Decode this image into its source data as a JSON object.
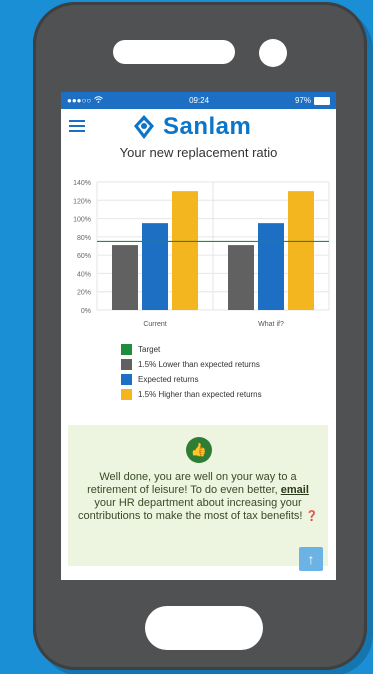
{
  "status": {
    "signal": "●●●○○",
    "wifi": "wifi-icon",
    "time": "09:24",
    "battery": "97%"
  },
  "header": {
    "brand": "Sanlam",
    "title": "Your new replacement ratio"
  },
  "chart_data": {
    "type": "bar",
    "categories": [
      "Current",
      "What if?"
    ],
    "ylim": [
      0,
      140
    ],
    "yticks": [
      "140%",
      "120%",
      "100%",
      "80%",
      "60%",
      "40%",
      "20%",
      "0%"
    ],
    "target": 75,
    "series": [
      {
        "name": "1.5% Lower than expected returns",
        "color": "#616161",
        "values": [
          71,
          71
        ]
      },
      {
        "name": "Expected returns",
        "color": "#1d6fc4",
        "values": [
          95,
          95
        ]
      },
      {
        "name": "1.5% Higher than expected returns",
        "color": "#f3b61f",
        "values": [
          130,
          130
        ]
      }
    ],
    "target_series": {
      "name": "Target",
      "color": "#1e8e3e"
    }
  },
  "legend": [
    {
      "label": "Target",
      "color": "#1e8e3e"
    },
    {
      "label": "1.5% Lower than expected returns",
      "color": "#616161"
    },
    {
      "label": "Expected returns",
      "color": "#1d6fc4"
    },
    {
      "label": "1.5% Higher than expected returns",
      "color": "#f3b61f"
    }
  ],
  "message": {
    "part1": "Well done, you are well on your way to a retirement of leisure! To do even better, ",
    "link": "email",
    "part2": " your HR department about increasing your contributions to make the most of tax benefits! ",
    "help_icon": "question-circle-icon"
  },
  "icons": {
    "thumbs_up": "thumbs-up-icon",
    "scroll_top": "arrow-up-icon"
  }
}
